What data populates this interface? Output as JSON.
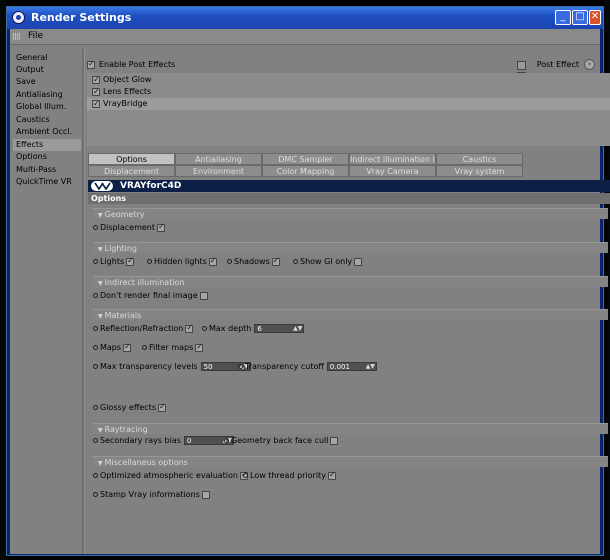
{
  "window": {
    "title": "Render Settings",
    "min": "_",
    "max": "□",
    "close": "✕"
  },
  "menu": {
    "file": "File"
  },
  "sidebar": {
    "items": [
      {
        "label": "General"
      },
      {
        "label": "Output"
      },
      {
        "label": "Save"
      },
      {
        "label": "Antialiasing"
      },
      {
        "label": "Global Illum."
      },
      {
        "label": "Caustics"
      },
      {
        "label": "Ambient Occl."
      },
      {
        "label": "Effects"
      },
      {
        "label": "Options"
      },
      {
        "label": "Multi-Pass"
      },
      {
        "label": "QuickTime VR"
      }
    ],
    "selected": "Effects"
  },
  "post_effects": {
    "enable_label": "Enable Post Effects",
    "menu_label": "Post Effect",
    "menu_button": "›"
  },
  "effects": [
    {
      "label": "Object Glow",
      "checked": true
    },
    {
      "label": "Lens Effects",
      "checked": true
    },
    {
      "label": "VrayBridge",
      "checked": true,
      "selected": true
    }
  ],
  "tabs": {
    "row1": [
      "Options",
      "Antialiasing",
      "DMC Sampler",
      "Indirect illumination (GI)",
      "Caustics"
    ],
    "row2": [
      "Displacement",
      "Environment",
      "Color Mapping",
      "Vray Camera",
      "Vray system"
    ],
    "active": "Options"
  },
  "banner": {
    "text": "VRAYforC4D"
  },
  "panel": {
    "heading": "Options"
  },
  "groups": {
    "geometry": "Geometry",
    "lighting": "Lighting",
    "indirect": "Indirect illumination",
    "materials": "Materials",
    "raytracing": "Raytracing",
    "misc": "Miscellaneus options"
  },
  "options": {
    "displacement": "Displacement",
    "lights": "Lights",
    "hidden_lights": "Hidden lights",
    "shadows": "Shadows",
    "show_gi_only": "Show GI only",
    "dont_render_final": "Don't render final image",
    "reflection_refraction": "Reflection/Refraction",
    "max_depth": "Max depth",
    "max_depth_value": "6",
    "maps": "Maps",
    "filter_maps": "Filter maps",
    "max_transparency_levels": "Max transparency levels",
    "max_transparency_value": "50",
    "transparency_cutoff": "Transparency cutoff",
    "transparency_cutoff_value": "0.001",
    "glossy_effects": "Glossy effects",
    "secondary_rays_bias": "Secondary rays bias",
    "secondary_rays_bias_value": "0",
    "geometry_back_face_cull": "Geometry back face cull",
    "optimized_atmospheric": "Optimized atmospheric evaluation",
    "low_thread_priority": "Low thread priority",
    "stamp_vray": "Stamp Vray informations"
  },
  "spinner_glyph": "▲▼"
}
